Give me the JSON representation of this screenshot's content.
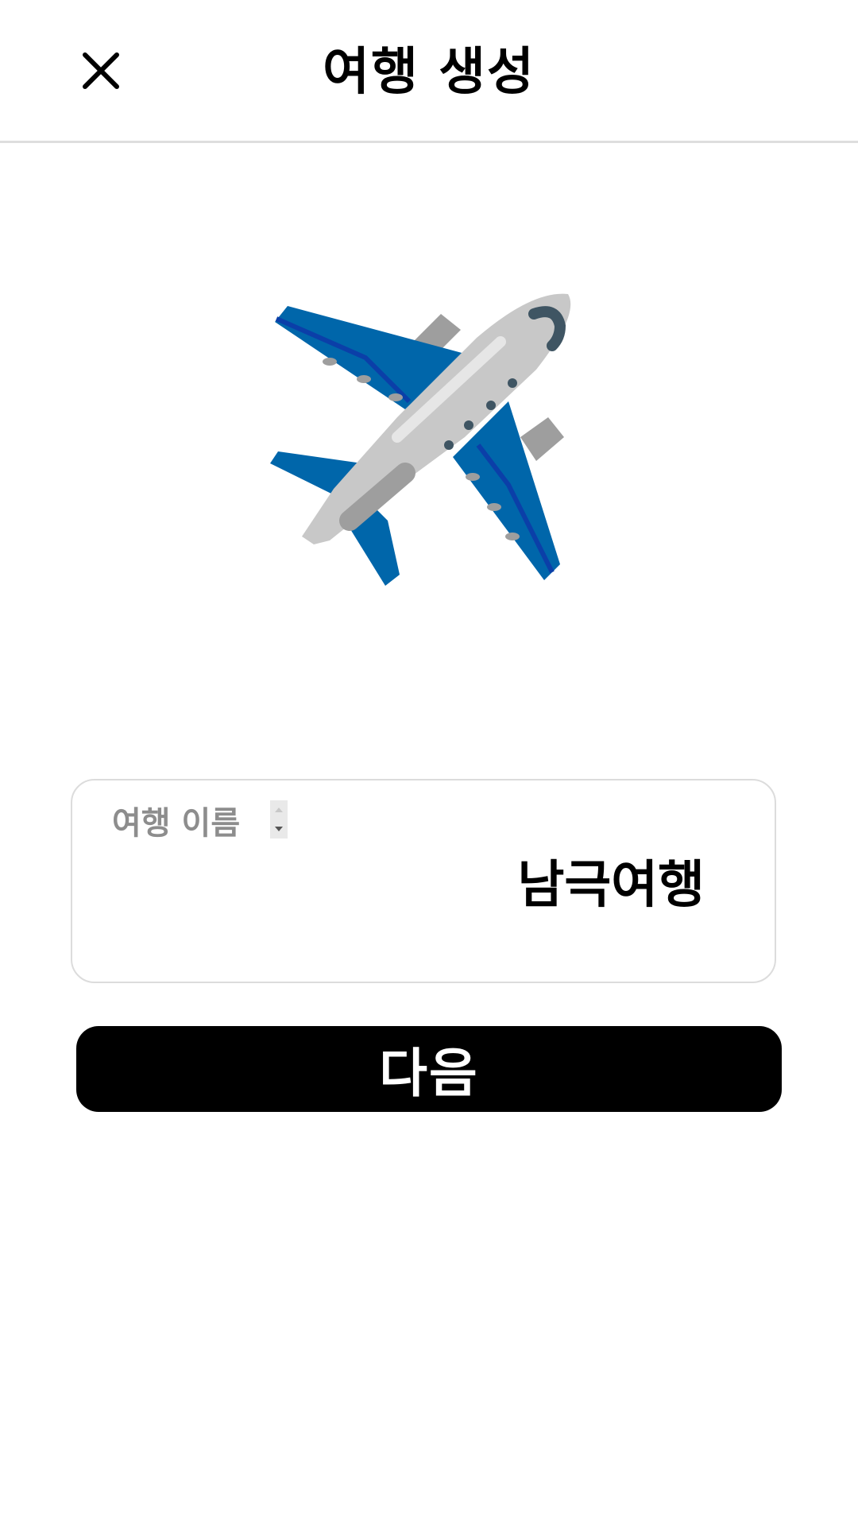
{
  "header": {
    "title": "여행 생성",
    "close_icon": "close-icon"
  },
  "hero": {
    "icon": "airplane-icon",
    "colors": {
      "wing": "#0066aa",
      "stripe": "#0b3fa8",
      "body": "#c8c8c8",
      "engine": "#9e9e9e",
      "window": "#3f5563"
    }
  },
  "trip_name_field": {
    "label": "여행 이름",
    "value": "남극여행"
  },
  "next_button": {
    "label": "다음"
  }
}
